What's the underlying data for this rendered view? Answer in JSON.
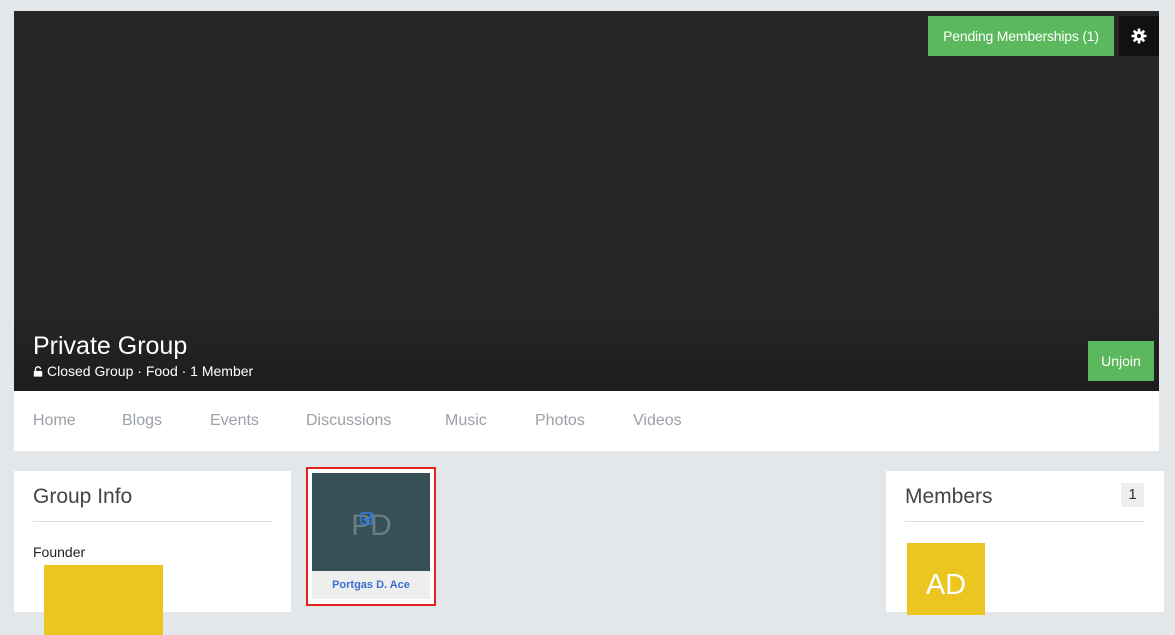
{
  "header": {
    "pending_label": "Pending Memberships (1)",
    "group_name": "Private Group",
    "group_meta": "Closed Group · Food · 1 Member",
    "unjoin_label": "Unjoin"
  },
  "nav": {
    "tabs": [
      {
        "label": "Home"
      },
      {
        "label": "Blogs"
      },
      {
        "label": "Events"
      },
      {
        "label": "Discussions"
      },
      {
        "label": "Music"
      },
      {
        "label": "Photos"
      },
      {
        "label": "Videos"
      }
    ]
  },
  "group_info": {
    "title": "Group Info",
    "founder_label": "Founder"
  },
  "member_card": {
    "initials": "PD",
    "name": "Portgas D. Ace"
  },
  "members_panel": {
    "title": "Members",
    "count": "1",
    "avatar_initials": "AD"
  },
  "colors": {
    "accent_green": "#5cb85c",
    "cover_dark": "#262626",
    "avatar_yellow": "#ebc620",
    "card_photo_bg": "#375057",
    "link_blue": "#3b6fd1",
    "highlight_red": "#e2231a"
  },
  "icons": {
    "settings": "gear-icon",
    "lock": "lock-icon",
    "checked": "checkbox-checked-icon"
  }
}
